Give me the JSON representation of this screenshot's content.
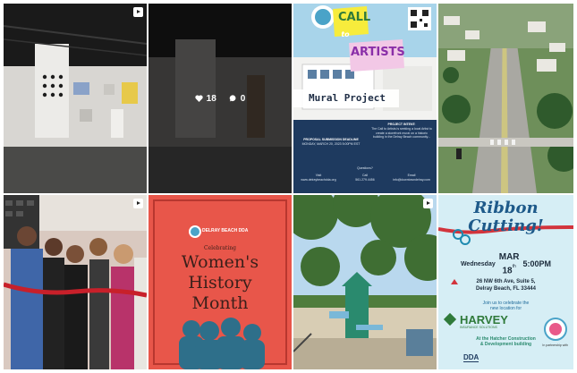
{
  "posts": [
    {
      "id_label": "gallery",
      "is_reel": true
    },
    {
      "id_label": "hover",
      "is_reel": false,
      "likes": "18",
      "comments": "0"
    },
    {
      "is_reel": false,
      "title_call": "CALL",
      "title_to": "to",
      "title_artists": "ARTISTS",
      "subtitle": "Mural Project",
      "intent_heading": "PROJECT INTENT:",
      "intent_text": "The Call to Artists is seeking a local Artist to create a storefront mural on a historic building in the Delray Beach community...",
      "deadline_heading": "PROPOSAL SUBMISSION DEADLINE",
      "deadline_text": "MONDAY, MARCH 20, 2023 5:00PM EST",
      "questions": "Questions?",
      "visit": "Visit",
      "call": "Call",
      "email": "Email",
      "visit_val": "www.delraybeachdda.org",
      "call_val": "561.279.4456",
      "email_val": "info@downtowndelray.com"
    },
    {
      "is_reel": false
    },
    {
      "is_reel": true
    },
    {
      "is_reel": false,
      "org": "DELRAY BEACH DDA",
      "celebrating": "Celebrating",
      "headline": "Women's History Month"
    },
    {
      "is_reel": true
    },
    {
      "is_reel": false,
      "headline1": "Ribbon",
      "headline2": "Cutting!",
      "day": "Wednesday",
      "month": "MAR",
      "date": "18",
      "date_sup": "th",
      "time": "5:00PM",
      "address1": "26 NW 6th Ave, Suite 5,",
      "address2": "Delray Beach, FL 33444",
      "invite1": "Join us to celebrate the",
      "invite2": "new location for",
      "brand": "HARVEY",
      "brand_sub": "INSURANCE SOLUTIONS",
      "location1": "At the Hatcher Construction",
      "location2": "& Development building",
      "partner": "In partnership with",
      "partner_logo": "DDA"
    }
  ],
  "colors": {
    "call_bg": "#1e3a5f",
    "whm_bg": "#e8564a",
    "ribbon_bg": "#d6eef5"
  }
}
